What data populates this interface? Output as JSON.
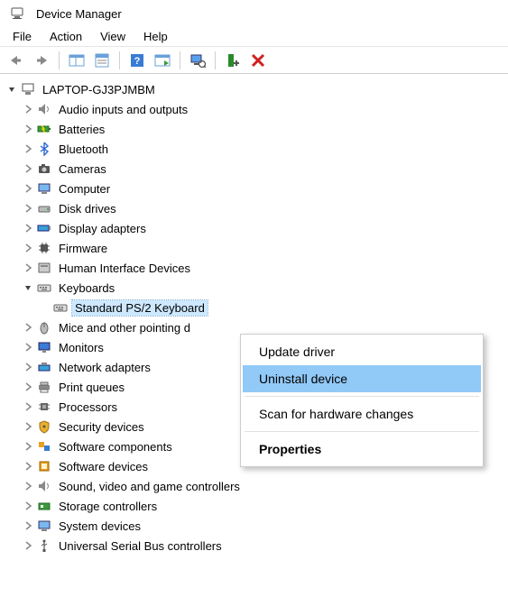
{
  "window": {
    "title": "Device Manager"
  },
  "menubar": {
    "file": "File",
    "action": "Action",
    "view": "View",
    "help": "Help"
  },
  "tree": {
    "root": "LAPTOP-GJ3PJMBM",
    "items": [
      {
        "label": "Audio inputs and outputs"
      },
      {
        "label": "Batteries"
      },
      {
        "label": "Bluetooth"
      },
      {
        "label": "Cameras"
      },
      {
        "label": "Computer"
      },
      {
        "label": "Disk drives"
      },
      {
        "label": "Display adapters"
      },
      {
        "label": "Firmware"
      },
      {
        "label": "Human Interface Devices"
      },
      {
        "label": "Keyboards",
        "expanded": true,
        "children": [
          {
            "label": "Standard PS/2 Keyboard",
            "selected": true
          }
        ]
      },
      {
        "label": "Mice and other pointing d"
      },
      {
        "label": "Monitors"
      },
      {
        "label": "Network adapters"
      },
      {
        "label": "Print queues"
      },
      {
        "label": "Processors"
      },
      {
        "label": "Security devices"
      },
      {
        "label": "Software components"
      },
      {
        "label": "Software devices"
      },
      {
        "label": "Sound, video and game controllers"
      },
      {
        "label": "Storage controllers"
      },
      {
        "label": "System devices"
      },
      {
        "label": "Universal Serial Bus controllers"
      }
    ]
  },
  "context_menu": {
    "update": "Update driver",
    "uninstall": "Uninstall device",
    "scan": "Scan for hardware changes",
    "properties": "Properties"
  }
}
